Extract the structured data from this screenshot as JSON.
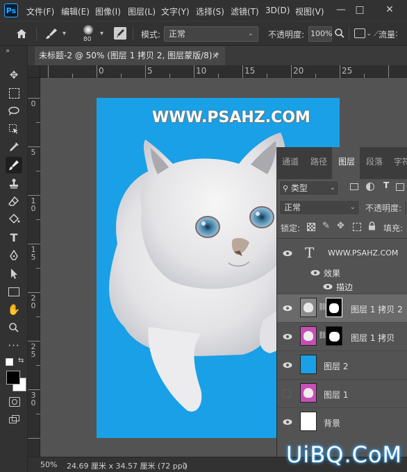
{
  "menu": {
    "logo": "Ps",
    "items": [
      "文件(F)",
      "编辑(E)",
      "图像(I)",
      "图层(L)",
      "文字(Y)",
      "选择(S)",
      "滤镜(T)",
      "3D(D)",
      "视图(V)"
    ],
    "minimize": "—",
    "maximize": "□",
    "close": "✕"
  },
  "options": {
    "brush_size": "80",
    "mode_label": "模式:",
    "mode_value": "正常",
    "opacity_label": "不透明度:",
    "opacity_value": "100%",
    "flow_label": "流量"
  },
  "document": {
    "tab_title": "未标题-2 @ 50% (图层 1 拷贝 2, 图层蒙版/8) *",
    "close": "×",
    "canvas_text": "WWW.PSAHZ.COM",
    "canvas_bg": "#1aa0e6"
  },
  "ruler": {
    "top_ticks": [
      "0",
      "5",
      "10",
      "15",
      "20",
      "25"
    ],
    "left_ticks": [
      [
        "0"
      ],
      [
        "5"
      ],
      [
        "1",
        "0"
      ],
      [
        "1",
        "5"
      ],
      [
        "2",
        "0"
      ],
      [
        "2",
        "5"
      ],
      [
        "3",
        "0"
      ]
    ]
  },
  "status": {
    "zoom": "50%",
    "doc_size": "24.69 厘米 x 34.57 厘米 (72 ppi)",
    "arrow": "〉"
  },
  "layers_panel": {
    "tabs": [
      "通道",
      "路径",
      "图层",
      "段落",
      "字符"
    ],
    "active_tab": "图层",
    "filter_kind": "类型",
    "blend_mode": "正常",
    "opacity_label": "不透明度:",
    "lock_label": "锁定:",
    "fill_label": "填充:",
    "layers": [
      {
        "name": "WWW.PSAHZ.COM",
        "type": "text",
        "visible": true
      },
      {
        "name": "效果",
        "type": "effects",
        "visible": true
      },
      {
        "name": "描边",
        "type": "effect",
        "visible": true
      },
      {
        "name": "图层 1 拷贝 2",
        "type": "masked",
        "visible": true,
        "selected": true
      },
      {
        "name": "图层 1 拷贝",
        "type": "masked",
        "visible": true
      },
      {
        "name": "图层 2",
        "type": "fill",
        "visible": true
      },
      {
        "name": "图层 1",
        "type": "image",
        "visible": false
      },
      {
        "name": "背景",
        "type": "background",
        "visible": true
      }
    ]
  },
  "watermark": "UiBQ.CoM",
  "colors": {
    "accent": "#31a8ff",
    "panel_bg": "#535353",
    "chrome": "#323232",
    "selected_layer": "#6a6a6a"
  }
}
